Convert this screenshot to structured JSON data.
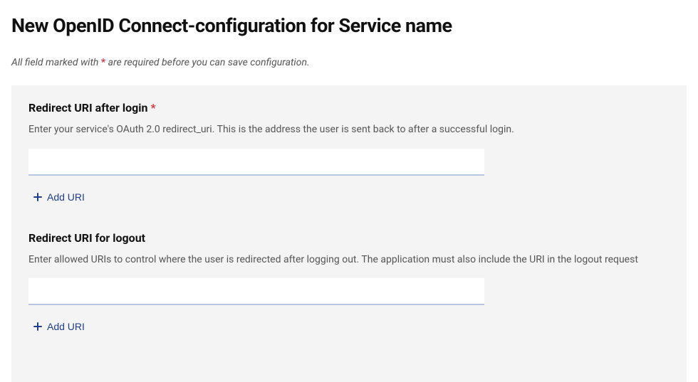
{
  "page_title": "New OpenID Connect-configuration for Service name",
  "required_note": {
    "prefix": "All field marked with ",
    "marker": "*",
    "suffix": " are required before you can save configuration."
  },
  "fields": {
    "login_redirect": {
      "label": "Redirect URI after login",
      "required": true,
      "required_marker": "*",
      "help": "Enter your service's OAuth 2.0 redirect_uri. This is the address the user is sent back to after a successful login.",
      "value": "",
      "add_button": "Add URI"
    },
    "logout_redirect": {
      "label": "Redirect URI for logout",
      "required": false,
      "help": "Enter allowed URIs to control where the user is redirected after logging out. The application must also include the URI in the logout request",
      "value": "",
      "add_button": "Add URI"
    }
  }
}
